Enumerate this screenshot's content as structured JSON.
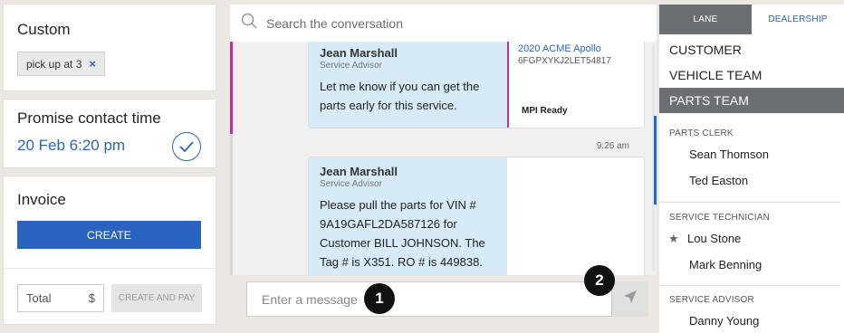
{
  "left": {
    "custom": {
      "title": "Custom",
      "chip_label": "pick up at 3",
      "chip_close": "×"
    },
    "promise": {
      "title": "Promise contact time",
      "date": "20 Feb 6:20 pm"
    },
    "invoice": {
      "title": "Invoice",
      "create_label": "CREATE",
      "total_placeholder": "Total",
      "currency": "$",
      "create_and_pay_label": "CREATE AND PAY"
    }
  },
  "search": {
    "placeholder": "Search the conversation",
    "icon": "search-icon"
  },
  "conversation": {
    "messages": [
      {
        "sender": "Jean Marshall",
        "role": "Service Advisor",
        "text": "Let me know if you can get the parts early for this service.",
        "vehicle": "2020 ACME Apollo",
        "vin": "6FGPXYKJ2LET54817",
        "status": "MPI Ready"
      },
      {
        "timestamp": "9:26 am",
        "sender": "Jean Marshall",
        "role": "Service Advisor",
        "text": "Please pull the parts for VIN # 9A19GAFL2DA587126  for Customer BILL JOHNSON. The Tag # is X351. RO # is 449838."
      }
    ]
  },
  "composer": {
    "placeholder": "Enter a message",
    "send_icon": "send-icon"
  },
  "markers": [
    "1",
    "2"
  ],
  "right": {
    "tabs": [
      "LANE",
      "DEALERSHIP"
    ],
    "teams": [
      "CUSTOMER",
      "VEHICLE TEAM",
      "PARTS TEAM"
    ],
    "groups": [
      {
        "label": "PARTS CLERK",
        "people": [
          "Sean Thomson",
          "Ted Easton"
        ]
      },
      {
        "label": "SERVICE TECHNICIAN",
        "people": [
          "Lou Stone",
          "Mark Benning"
        ]
      },
      {
        "label": "SERVICE ADVISOR",
        "people": [
          "Danny Young"
        ]
      }
    ]
  },
  "colors": {
    "accent": "#2a63c0",
    "highlight": "#c62d9a",
    "tab_active": "#6b6e73",
    "bubble": "#d6ebf7"
  }
}
